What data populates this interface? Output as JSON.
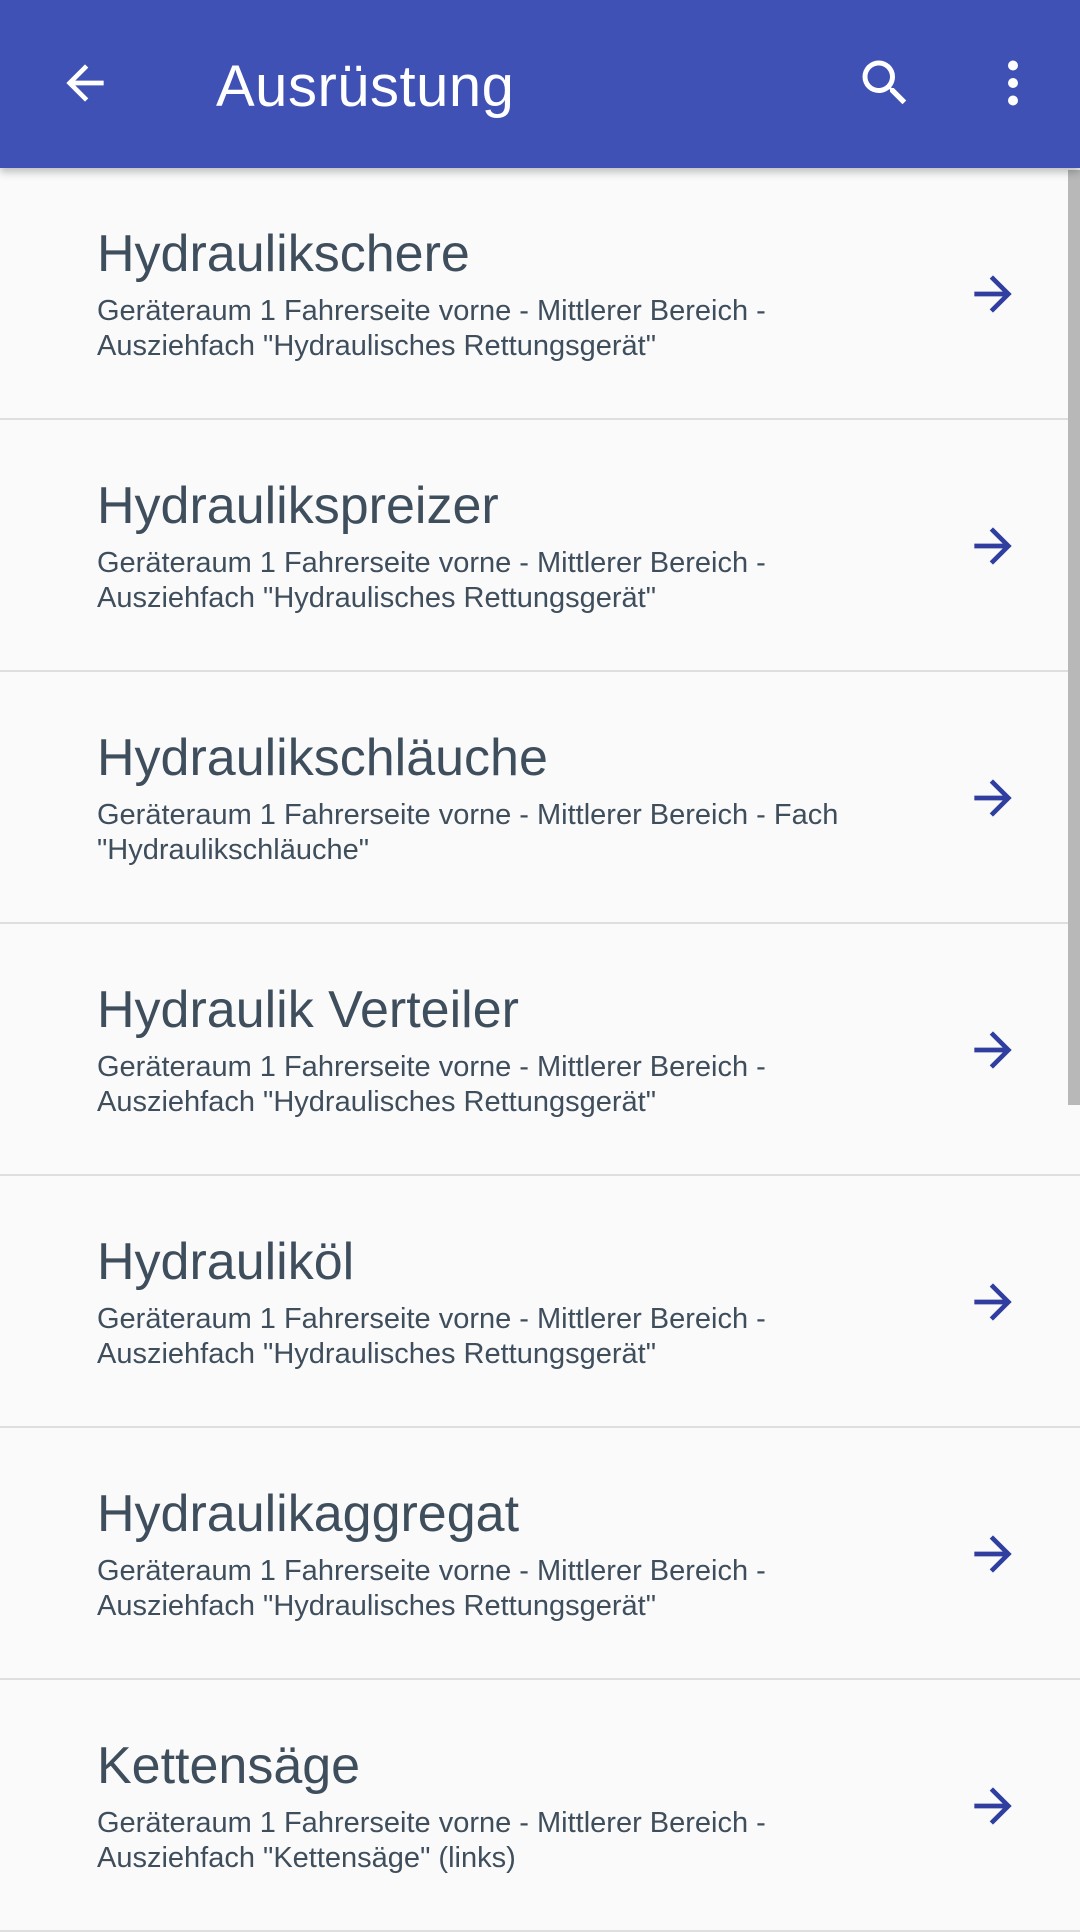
{
  "appbar": {
    "title": "Ausrüstung",
    "back_icon": "arrow-left-icon",
    "search_icon": "search-icon",
    "more_icon": "more-vert-icon",
    "color": "#3f51b5"
  },
  "items": [
    {
      "name": "Hydraulikschere",
      "location": "Geräteraum 1 Fahrerseite vorne - Mittlerer Bereich - Ausziehfach \"Hydraulisches Rettungsgerät\""
    },
    {
      "name": "Hydraulikspreizer",
      "location": "Geräteraum 1 Fahrerseite vorne - Mittlerer Bereich - Ausziehfach \"Hydraulisches Rettungsgerät\""
    },
    {
      "name": "Hydraulikschläuche",
      "location": "Geräteraum 1 Fahrerseite vorne - Mittlerer Bereich - Fach \"Hydraulikschläuche\""
    },
    {
      "name": "Hydraulik Verteiler",
      "location": "Geräteraum 1 Fahrerseite vorne - Mittlerer Bereich - Ausziehfach \"Hydraulisches Rettungsgerät\""
    },
    {
      "name": "Hydrauliköl",
      "location": "Geräteraum 1 Fahrerseite vorne - Mittlerer Bereich - Ausziehfach \"Hydraulisches Rettungsgerät\""
    },
    {
      "name": "Hydraulikaggregat",
      "location": "Geräteraum 1 Fahrerseite vorne - Mittlerer Bereich - Ausziehfach \"Hydraulisches Rettungsgerät\""
    },
    {
      "name": "Kettensäge",
      "location": "Geräteraum 1 Fahrerseite vorne - Mittlerer Bereich - Ausziehfach \"Kettensäge\" (links)"
    }
  ],
  "item_arrow_icon": "arrow-right-icon",
  "accent_color": "#303f9f",
  "text_color": "#3f4e5c"
}
